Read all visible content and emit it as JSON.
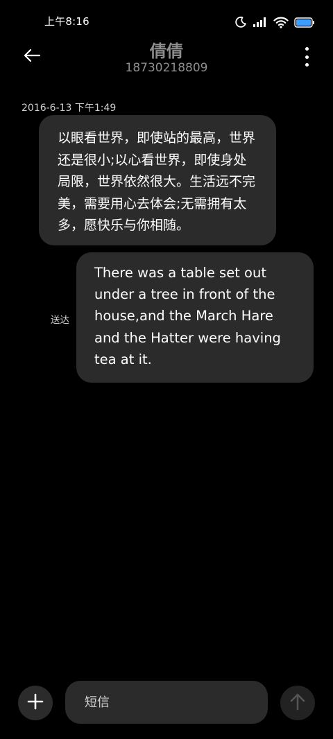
{
  "status_bar": {
    "time": "上午8:16",
    "icons": [
      "moon-icon",
      "signal-icon",
      "wifi-icon",
      "battery-icon"
    ]
  },
  "header": {
    "back_icon": "arrow-left-icon",
    "contact_name": "倩倩",
    "contact_number": "18730218809",
    "more_icon": "more-vertical-icon"
  },
  "conversation": {
    "timestamp": "2016-6-13 下午1:49",
    "messages": [
      {
        "direction": "incoming",
        "text": "以眼看世界，即使站的最高，世界还是很小;以心看世界，即使身处局限，世界依然很大。生活远不完美，需要用心去体会;无需拥有太多，愿快乐与你相随。"
      },
      {
        "direction": "outgoing",
        "text": "There was a table set out under a tree in front of the house,and the March Hare and the Hatter were having tea at it.",
        "status": "送达"
      }
    ]
  },
  "input_bar": {
    "add_icon": "plus-icon",
    "placeholder": "短信",
    "send_icon": "arrow-up-icon"
  },
  "colors": {
    "background": "#000000",
    "bubble": "#2b2b2b",
    "header_text": "#8e8e8e",
    "battery": "#3d9dff"
  }
}
